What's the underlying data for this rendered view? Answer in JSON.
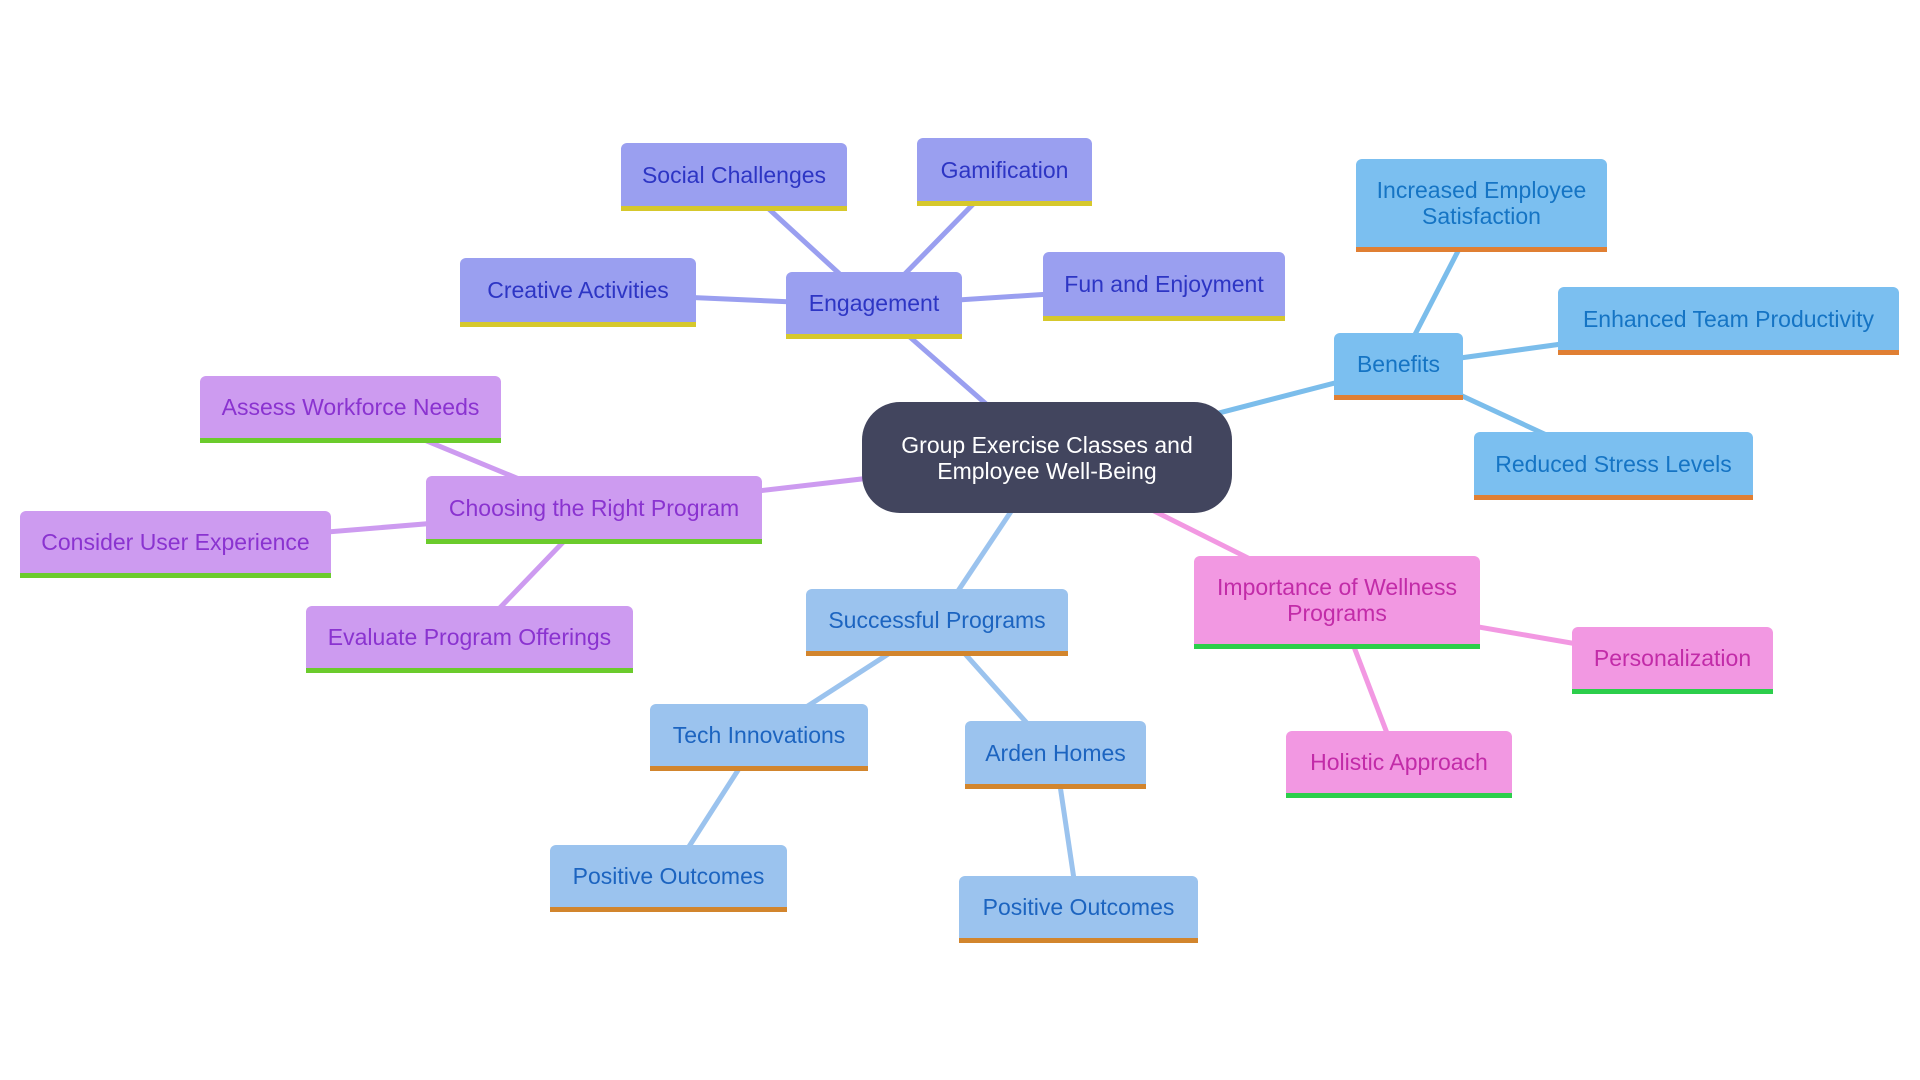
{
  "root": {
    "label": "Group Exercise Classes and\nEmployee Well-Being"
  },
  "branches": [
    {
      "id": "engagement",
      "label": "Engagement",
      "color": "#9a9ff0",
      "edge_color": "#9a9ff0",
      "children": [
        {
          "label": "Social Challenges"
        },
        {
          "label": "Gamification"
        },
        {
          "label": "Creative Activities"
        },
        {
          "label": "Fun and Enjoyment"
        }
      ]
    },
    {
      "id": "benefits",
      "label": "Benefits",
      "color": "#7bbff0",
      "edge_color": "#7bbdeb",
      "children": [
        {
          "label": "Increased Employee\nSatisfaction"
        },
        {
          "label": "Enhanced Team Productivity"
        },
        {
          "label": "Reduced Stress Levels"
        }
      ]
    },
    {
      "id": "choosing",
      "label": "Choosing the Right Program",
      "color": "#cd9bf0",
      "edge_color": "#cd9bf0",
      "children": [
        {
          "label": "Assess Workforce Needs"
        },
        {
          "label": "Consider User Experience"
        },
        {
          "label": "Evaluate Program Offerings"
        }
      ]
    },
    {
      "id": "successful",
      "label": "Successful Programs",
      "color": "#9bc3ee",
      "edge_color": "#9bc3ee",
      "children": [
        {
          "label": "Tech Innovations",
          "children": [
            {
              "label": "Positive Outcomes"
            }
          ]
        },
        {
          "label": "Arden Homes",
          "children": [
            {
              "label": "Positive Outcomes"
            }
          ]
        }
      ]
    },
    {
      "id": "importance",
      "label": "Importance of Wellness\nPrograms",
      "color": "#f298e2",
      "edge_color": "#f298e2",
      "children": [
        {
          "label": "Personalization"
        },
        {
          "label": "Holistic Approach"
        }
      ]
    }
  ]
}
